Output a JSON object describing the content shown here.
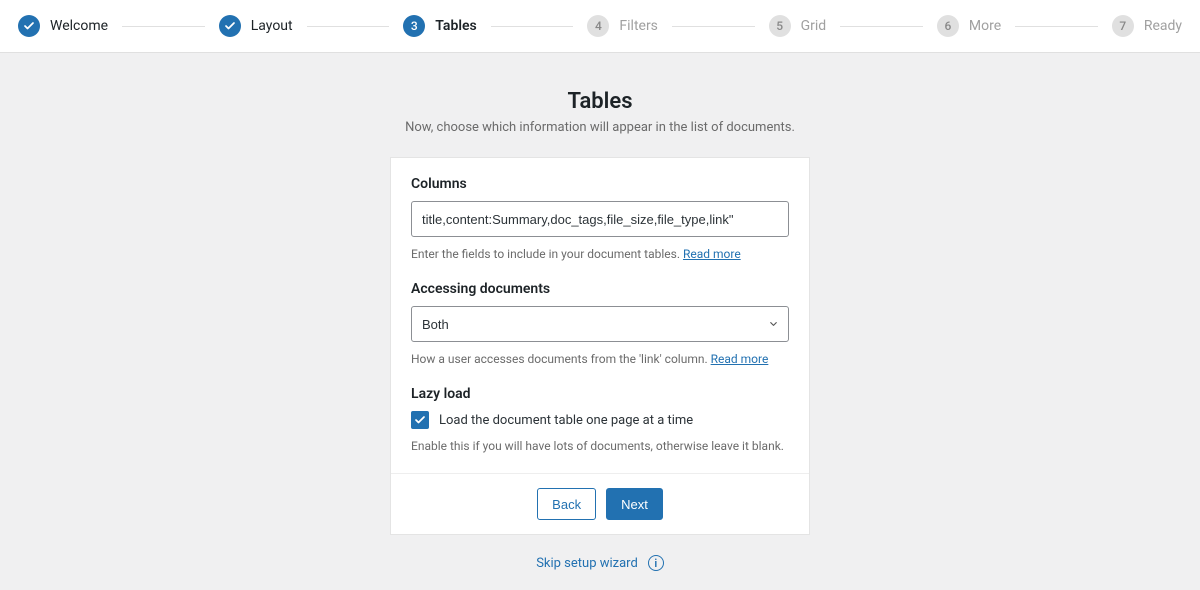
{
  "stepper": {
    "steps": [
      {
        "label": "Welcome",
        "state": "done"
      },
      {
        "label": "Layout",
        "state": "done"
      },
      {
        "label": "Tables",
        "state": "active",
        "number": "3"
      },
      {
        "label": "Filters",
        "state": "future",
        "number": "4"
      },
      {
        "label": "Grid",
        "state": "future",
        "number": "5"
      },
      {
        "label": "More",
        "state": "future",
        "number": "6"
      },
      {
        "label": "Ready",
        "state": "future",
        "number": "7"
      }
    ]
  },
  "header": {
    "title": "Tables",
    "subtitle": "Now, choose which information will appear in the list of documents."
  },
  "form": {
    "columns": {
      "label": "Columns",
      "value": "title,content:Summary,doc_tags,file_size,file_type,link\"",
      "hint_text": "Enter the fields to include in your document tables. ",
      "hint_link": "Read more"
    },
    "access": {
      "label": "Accessing documents",
      "value": "Both",
      "hint_text": "How a user accesses documents from the 'link' column. ",
      "hint_link": "Read more"
    },
    "lazy": {
      "label": "Lazy load",
      "checkbox_label": "Load the document table one page at a time",
      "checked": true,
      "hint": "Enable this if you will have lots of documents, otherwise leave it blank."
    }
  },
  "footer": {
    "back": "Back",
    "next": "Next"
  },
  "skip": {
    "label": "Skip setup wizard"
  },
  "colors": {
    "primary": "#2271b1"
  }
}
